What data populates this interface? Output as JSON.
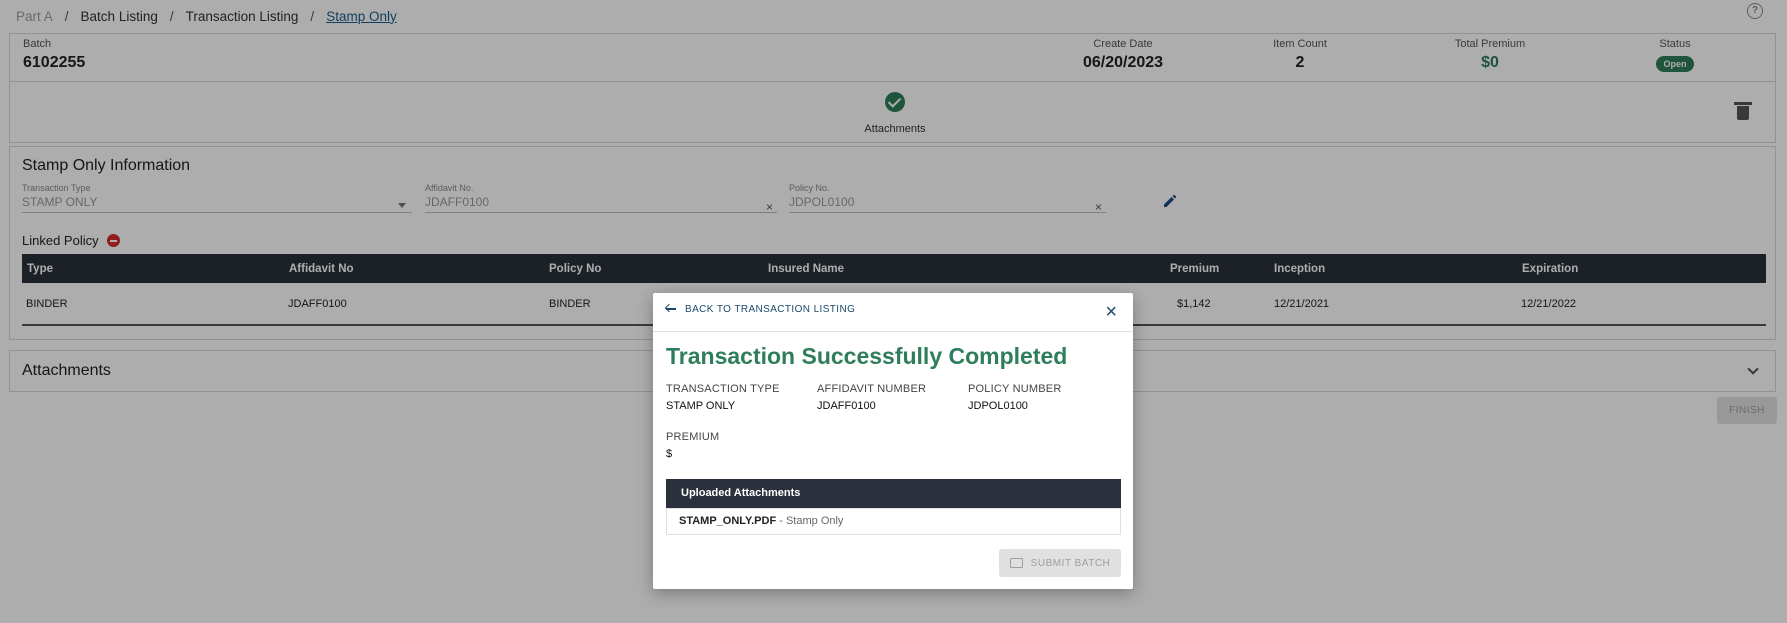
{
  "breadcrumb": {
    "items": [
      "Part A",
      "Batch Listing",
      "Transaction Listing",
      "Stamp Only"
    ]
  },
  "batch": {
    "label": "Batch",
    "id": "6102255",
    "create_date_label": "Create Date",
    "create_date": "06/20/2023",
    "item_count_label": "Item Count",
    "item_count": "2",
    "total_premium_label": "Total Premium",
    "total_premium": "$0",
    "status_label": "Status",
    "status": "Open"
  },
  "steps": {
    "attachments_label": "Attachments"
  },
  "stamp_info": {
    "title": "Stamp Only Information",
    "transaction_type_label": "Transaction Type",
    "transaction_type": "STAMP ONLY",
    "affidavit_label": "Affidavit No.",
    "affidavit": "JDAFF0100",
    "policy_label": "Policy No.",
    "policy": "JDPOL0100",
    "clear_glyph": "×",
    "linked_policy_label": "Linked Policy"
  },
  "policy_table": {
    "headers": {
      "type": "Type",
      "affidavit": "Affidavit No",
      "policy": "Policy No",
      "insured": "Insured Name",
      "premium": "Premium",
      "inception": "Inception",
      "expiration": "Expiration"
    },
    "row": {
      "type": "BINDER",
      "affidavit": "JDAFF0100",
      "policy": "BINDER",
      "insured": "",
      "premium": "$1,142",
      "inception": "12/21/2021",
      "expiration": "12/21/2022"
    }
  },
  "attachments_section": {
    "title": "Attachments"
  },
  "finish_label": "FINISH",
  "modal": {
    "back_label": "BACK TO TRANSACTION LISTING",
    "close_glyph": "×",
    "title": "Transaction Successfully Completed",
    "transaction_type_label": "TRANSACTION TYPE",
    "transaction_type": "STAMP ONLY",
    "affidavit_label": "AFFIDAVIT NUMBER",
    "affidavit": "JDAFF0100",
    "policy_label": "POLICY NUMBER",
    "policy": "JDPOL0100",
    "premium_label": "PREMIUM",
    "premium": "$",
    "uploaded_header": "Uploaded Attachments",
    "uploaded_file": "STAMP_ONLY.PDF",
    "uploaded_sep": " - ",
    "uploaded_desc": "Stamp Only",
    "submit_label": "SUBMIT BATCH"
  },
  "colors": {
    "accent_green": "#2e7d5b",
    "table_header": "#2a313c",
    "link_blue": "#1b4a6b",
    "danger_red": "#d32f2f"
  },
  "icons": [
    "help-icon",
    "check-circle-icon",
    "trash-icon",
    "pencil-icon",
    "minus-circle-icon",
    "chevron-down-icon",
    "back-arrow-icon",
    "close-icon",
    "folder-upload-icon",
    "dropdown-caret-icon"
  ]
}
